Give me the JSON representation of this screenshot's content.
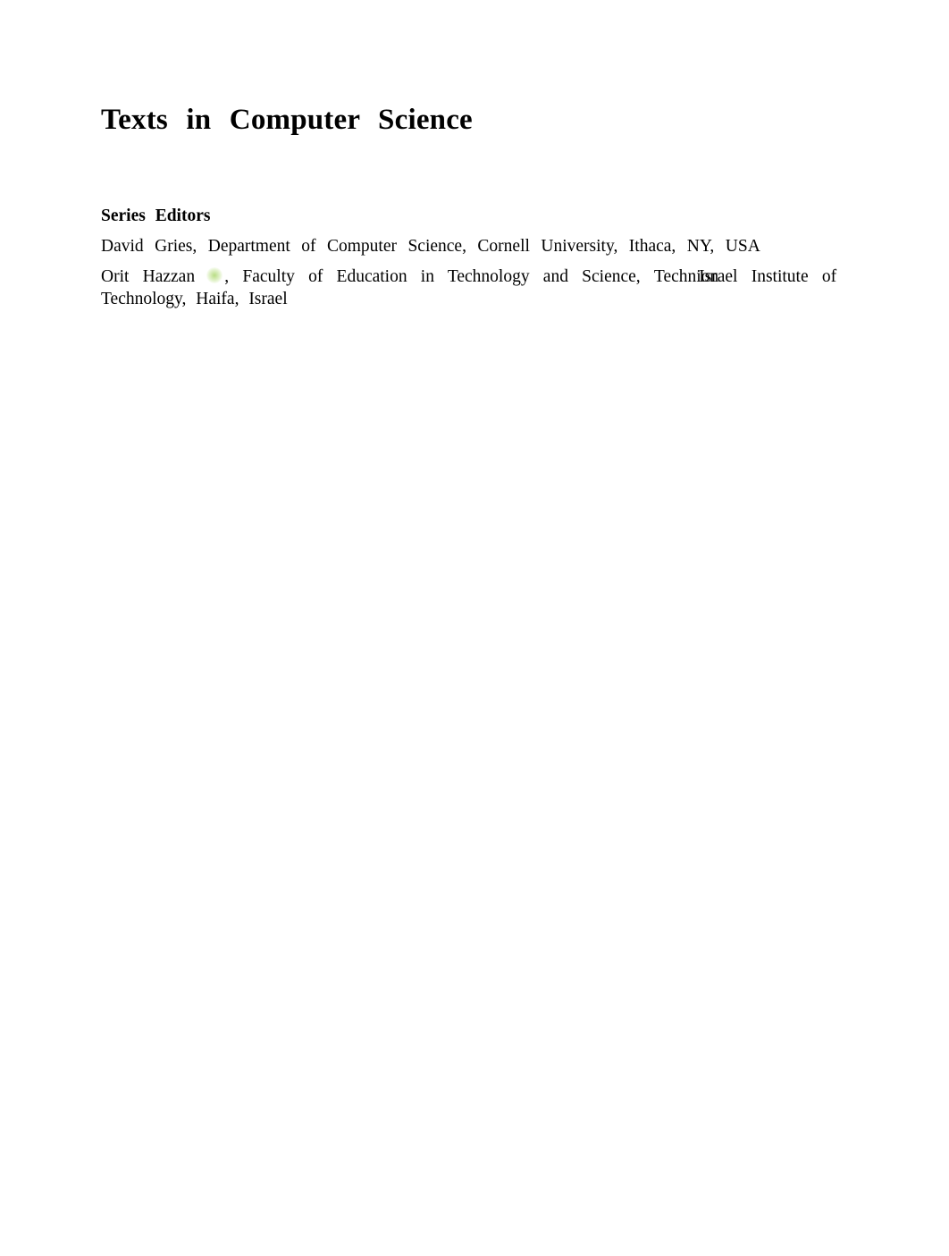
{
  "page": {
    "title": "Texts in Computer Science",
    "section_heading": "Series Editors",
    "editors": [
      {
        "name": "David Gries",
        "affiliation": "Department of Computer Science, Cornell University, Ithaca, NY, USA",
        "icon": null
      },
      {
        "name": "Orit Hazzan",
        "icon": "orcid-icon",
        "affiliation_part1": "Faculty of Education in Technology and Science,",
        "affiliation_institution_a": "Technion",
        "affiliation_institution_b": "Israel",
        "affiliation_part2": "Institute of",
        "affiliation_line2": "Technology, Haifa, Israel"
      }
    ]
  }
}
